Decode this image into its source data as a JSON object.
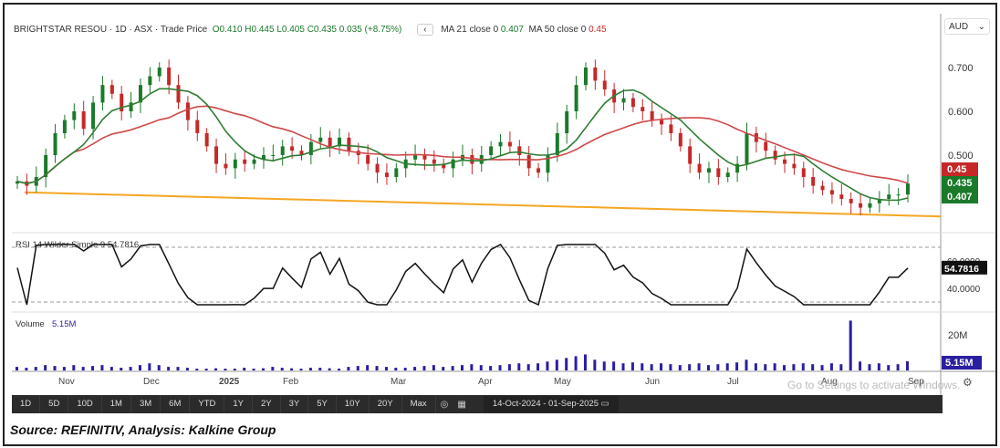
{
  "header": {
    "symbol": "BRIGHTSTAR RESOU",
    "interval": "1D",
    "exchange": "ASX",
    "price_type": "Trade Price",
    "open": "O0.410",
    "high": "H0.445",
    "low": "L0.405",
    "close": "C0.435",
    "change": "0.035 (+8.75%)",
    "collapse_icon": "chevron-left-icon",
    "ma21_label": "MA 21 close 0",
    "ma21_value": "0.407",
    "ma50_label": "MA 50 close 0",
    "ma50_value": "0.45"
  },
  "currency": "AUD",
  "colors": {
    "up": "#1b7a2a",
    "down": "#c62828",
    "ma21": "#2e7d32",
    "ma50": "#d04848",
    "trend": "#f5a623",
    "volume": "#2a1fa0",
    "rsi": "#111111"
  },
  "chart_data": {
    "type": "candlestick",
    "price_axis": {
      "ticks": [
        "0.700",
        "0.600",
        "0.500"
      ],
      "tick_values": [
        0.7,
        0.6,
        0.5
      ],
      "range": [
        0.329,
        0.808
      ]
    },
    "price_tags": [
      {
        "label": "0.45",
        "color": "#c62828",
        "value": 0.45
      },
      {
        "label": "0.435",
        "color": "#1b7a2a",
        "value": 0.435
      },
      {
        "label": "0.407",
        "color": "#1b7a2a",
        "value": 0.407
      }
    ],
    "closes": [
      0.44,
      0.43,
      0.45,
      0.5,
      0.55,
      0.58,
      0.6,
      0.56,
      0.62,
      0.66,
      0.64,
      0.6,
      0.62,
      0.66,
      0.68,
      0.7,
      0.66,
      0.62,
      0.58,
      0.55,
      0.52,
      0.48,
      0.47,
      0.49,
      0.48,
      0.49,
      0.5,
      0.5,
      0.52,
      0.51,
      0.5,
      0.53,
      0.54,
      0.52,
      0.54,
      0.51,
      0.5,
      0.48,
      0.46,
      0.45,
      0.47,
      0.49,
      0.5,
      0.49,
      0.48,
      0.47,
      0.49,
      0.5,
      0.48,
      0.5,
      0.52,
      0.53,
      0.52,
      0.5,
      0.47,
      0.46,
      0.5,
      0.55,
      0.6,
      0.66,
      0.7,
      0.67,
      0.65,
      0.62,
      0.63,
      0.61,
      0.6,
      0.58,
      0.57,
      0.55,
      0.52,
      0.48,
      0.46,
      0.47,
      0.45,
      0.46,
      0.48,
      0.55,
      0.53,
      0.51,
      0.49,
      0.48,
      0.47,
      0.45,
      0.43,
      0.42,
      0.41,
      0.4,
      0.39,
      0.38,
      0.39,
      0.4,
      0.41,
      0.41,
      0.435
    ],
    "trendline": {
      "start": 0.415,
      "end": 0.36
    },
    "ma_windows": [
      7,
      17
    ],
    "rsi": {
      "label": "RSI 14 Wilder Simple 9",
      "value": "54.7816",
      "ticks": [
        "60.0000",
        "40.0000"
      ],
      "tick_values": [
        60,
        40
      ],
      "bands": [
        70,
        30
      ]
    },
    "volume": {
      "label": "Volume",
      "value": "5.15M",
      "ticks": [
        "20M"
      ],
      "tick_values": [
        20
      ],
      "values": [
        2,
        1.5,
        2,
        3,
        2.5,
        2,
        3,
        2,
        2.5,
        3,
        2,
        1.5,
        2,
        3,
        4,
        3,
        2,
        2,
        1.5,
        1,
        1,
        1.2,
        1,
        1,
        1.5,
        1,
        1.2,
        2,
        1.5,
        1.2,
        1,
        1.5,
        1.5,
        1.2,
        1,
        2,
        2.5,
        3,
        2.5,
        2,
        1.5,
        1.5,
        2,
        2.5,
        3,
        2,
        2.5,
        3,
        3.5,
        3,
        2.5,
        3,
        3.5,
        4,
        3.5,
        4,
        5,
        6,
        7,
        8,
        9,
        6,
        5,
        5,
        4,
        4.5,
        4,
        3.5,
        4,
        3.5,
        3,
        3.5,
        4,
        3,
        3.5,
        4,
        4.5,
        6,
        4,
        3.5,
        4,
        3,
        3.5,
        4,
        3.5,
        3,
        4,
        3.5,
        28,
        5,
        3.5,
        4,
        3,
        3.5,
        5.15
      ]
    },
    "x_axis": {
      "ticks": [
        "Nov",
        "Dec",
        "2025",
        "Feb",
        "Mar",
        "Apr",
        "May",
        "Jun",
        "Jul",
        "Aug",
        "Sep"
      ],
      "tick_index": [
        6,
        17,
        24,
        34,
        47,
        59,
        68,
        79,
        89,
        99,
        94
      ]
    }
  },
  "toolbar": {
    "buttons": [
      "1D",
      "5D",
      "10D",
      "1M",
      "3M",
      "6M",
      "YTD",
      "1Y",
      "2Y",
      "3Y",
      "5Y",
      "10Y",
      "20Y",
      "Max"
    ],
    "date_range": "14-Oct-2024  -  01-Sep-2025"
  },
  "watermark": "Go to Settings to activate Windows.",
  "source": "Source: REFINITIV, Analysis: Kalkine Group"
}
